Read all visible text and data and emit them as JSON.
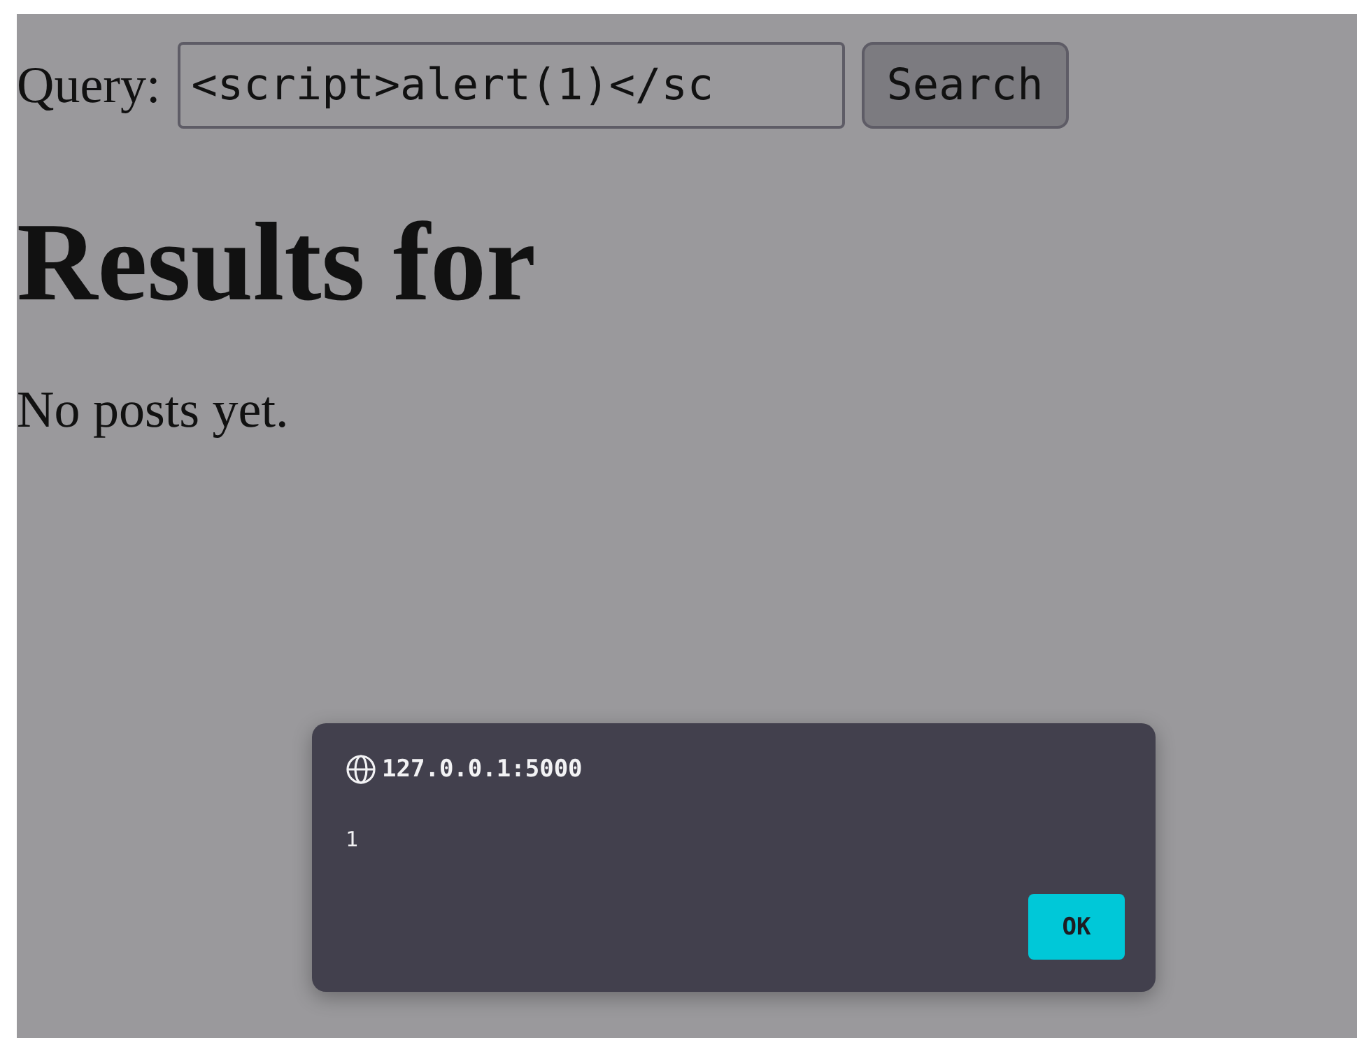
{
  "search": {
    "label": "Query:",
    "value": "<script>alert(1)</sc",
    "button": "Search"
  },
  "heading": "Results for",
  "message": "No posts yet.",
  "alert_dialog": {
    "origin": "127.0.0.1:5000",
    "text": "1",
    "button": "OK"
  }
}
